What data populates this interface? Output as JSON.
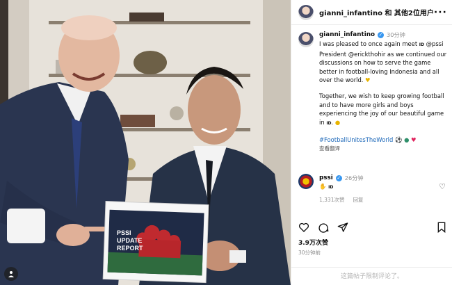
{
  "post": {
    "header": {
      "title": "gianni_infantino 和 其他2位用户",
      "more": "···"
    },
    "caption": {
      "username": "gianni_infantino",
      "time": "30分钟",
      "p1": "I was pleased to once again meet ",
      "p1_flag": "ID",
      "p1_rest": " @pssi President @erickthohir as we continued our discussions on how to serve the game better in football-loving Indonesia and all over the world.",
      "p2": "Together, we wish to keep growing football and to have more girls and boys experiencing the joy of our beautiful game in ",
      "p2_flag": "ID",
      "tags": "#FootballUnitesTheWorld",
      "translate": "查看翻译"
    },
    "comment": {
      "username": "pssi",
      "time": "26分钟",
      "text": "ID",
      "likes": "1,331次赞",
      "reply": "回复"
    },
    "likes": "3.9万次赞",
    "ago": "30分钟前",
    "footer": "这篇帖子限制评论了。"
  },
  "photo": {
    "board_text": "PSSI UPDATE REPORT"
  },
  "colors": {
    "link": "#1a66b8",
    "verified": "#3897f0",
    "muted": "#8e8e8e"
  }
}
